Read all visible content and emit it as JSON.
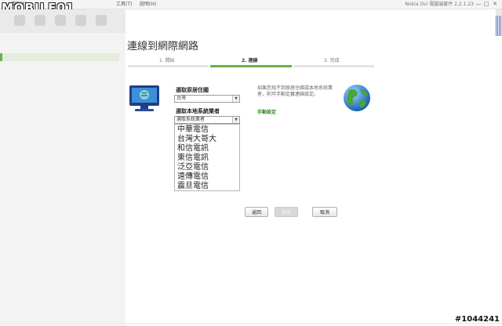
{
  "menu": {
    "items": [
      "檔案(F)",
      "工具(T)",
      "說明(H)"
    ]
  },
  "app_title": "Nokia Ovi 電腦端套件 2.2.1.23",
  "window_controls": [
    "—",
    "□",
    "✕"
  ],
  "watermark": {
    "logo": "MOBILE01",
    "id": "#1044241"
  },
  "page": {
    "title": "連線到網際網路"
  },
  "steps": [
    {
      "label": "1. 開始",
      "active": false
    },
    {
      "label": "2. 連線",
      "active": true
    },
    {
      "label": "3. 完成",
      "active": false
    }
  ],
  "form": {
    "country_label": "選取原居住國",
    "country_value": "台灣",
    "operator_label": "選取本地系統業者",
    "operator_value": "選取系統業者",
    "operator_options": [
      "中華電信",
      "台灣大哥大",
      "和信電訊",
      "東信電訊",
      "泛亞電信",
      "遠傳電信",
      "震旦電信"
    ]
  },
  "help": {
    "text": "如果您找不到原居住國或本地系統業者，則可手動定義連線設定。",
    "link": "手動設定"
  },
  "buttons": {
    "back": "返回",
    "next": "繼續",
    "cancel": "取消"
  },
  "colors": {
    "accent": "#6ab04c",
    "link": "#3a8a2a"
  },
  "icons": [
    "computer-monitor-icon",
    "globe-icon",
    "chevron-down-icon"
  ]
}
